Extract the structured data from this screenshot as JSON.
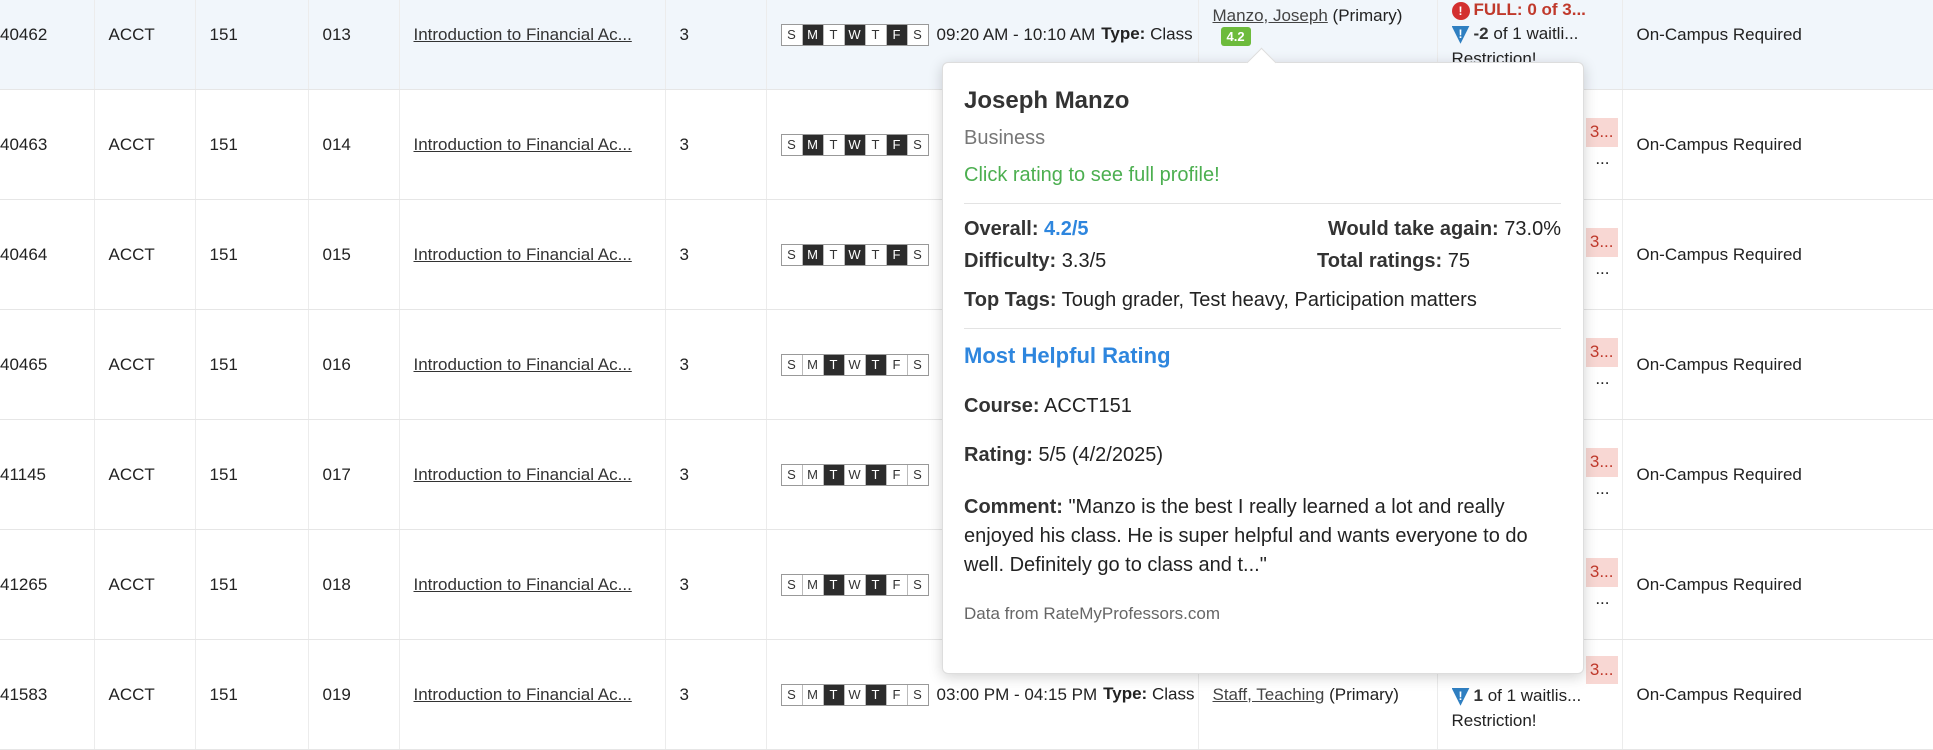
{
  "rows": [
    {
      "crn": "40462",
      "subject": "ACCT",
      "course": "151",
      "section": "013",
      "title": "Introduction to Financial Ac...",
      "credits": "3",
      "days_on": [
        false,
        true,
        false,
        true,
        false,
        true,
        false
      ],
      "time": "09:20 AM - 10:10 AM",
      "type_label": "Type:",
      "type_value": "Class",
      "instructor": "Manzo, Joseph",
      "role": "(Primary)",
      "rating": "4.2",
      "seats_status": "FULL:",
      "seats_text": "0 of 3...",
      "wait_count": "-2",
      "wait_text": "of 1 waitli...",
      "restriction": "Restriction!",
      "campus": "On-Campus Required"
    },
    {
      "crn": "40463",
      "subject": "ACCT",
      "course": "151",
      "section": "014",
      "title": "Introduction to Financial Ac...",
      "credits": "3",
      "days_on": [
        false,
        true,
        false,
        true,
        false,
        true,
        false
      ],
      "seats_pill": "3...",
      "seats_more": "...",
      "campus": "On-Campus Required"
    },
    {
      "crn": "40464",
      "subject": "ACCT",
      "course": "151",
      "section": "015",
      "title": "Introduction to Financial Ac...",
      "credits": "3",
      "days_on": [
        false,
        true,
        false,
        true,
        false,
        true,
        false
      ],
      "seats_pill": "3...",
      "seats_more": "...",
      "campus": "On-Campus Required"
    },
    {
      "crn": "40465",
      "subject": "ACCT",
      "course": "151",
      "section": "016",
      "title": "Introduction to Financial Ac...",
      "credits": "3",
      "days_on": [
        false,
        false,
        true,
        false,
        true,
        false,
        false
      ],
      "seats_pill": "3...",
      "seats_more": "...",
      "campus": "On-Campus Required"
    },
    {
      "crn": "41145",
      "subject": "ACCT",
      "course": "151",
      "section": "017",
      "title": "Introduction to Financial Ac...",
      "credits": "3",
      "days_on": [
        false,
        false,
        true,
        false,
        true,
        false,
        false
      ],
      "seats_pill": "3...",
      "seats_more": "...",
      "campus": "On-Campus Required"
    },
    {
      "crn": "41265",
      "subject": "ACCT",
      "course": "151",
      "section": "018",
      "title": "Introduction to Financial Ac...",
      "credits": "3",
      "days_on": [
        false,
        false,
        true,
        false,
        true,
        false,
        false
      ],
      "seats_pill": "3...",
      "seats_more": "...",
      "campus": "On-Campus Required"
    },
    {
      "crn": "41583",
      "subject": "ACCT",
      "course": "151",
      "section": "019",
      "title": "Introduction to Financial Ac...",
      "credits": "3",
      "days_on": [
        false,
        false,
        true,
        false,
        true,
        false,
        false
      ],
      "time": "03:00 PM - 04:15 PM",
      "type_label": "Type:",
      "type_value": "Class",
      "instructor": "Staff, Teaching",
      "role": "(Primary)",
      "seats_pill": "3...",
      "wait_count": "1",
      "wait_text": "of 1 waitlis...",
      "restriction": "Restriction!",
      "campus": "On-Campus Required"
    }
  ],
  "day_letters": [
    "S",
    "M",
    "T",
    "W",
    "T",
    "F",
    "S"
  ],
  "popover": {
    "name": "Joseph Manzo",
    "department": "Business",
    "profile_link": "Click rating to see full profile!",
    "overall_label": "Overall:",
    "overall_value": "4.2/5",
    "again_label": "Would take again:",
    "again_value": "73.0%",
    "difficulty_label": "Difficulty:",
    "difficulty_value": "3.3/5",
    "total_label": "Total ratings:",
    "total_value": "75",
    "tags_label": "Top Tags:",
    "tags_value": "Tough grader, Test heavy, Participation matters",
    "helpful_heading": "Most Helpful Rating",
    "course_label": "Course:",
    "course_value": "ACCT151",
    "rating_label": "Rating:",
    "rating_value": "5/5 (4/2/2025)",
    "comment_label": "Comment:",
    "comment_value": "\"Manzo is the best I really learned a lot and really enjoyed his class. He is super helpful and wants everyone to do well. Definitely go to class and t...\"",
    "source": "Data from RateMyProfessors.com"
  },
  "colors": {
    "accent": "#2e86de",
    "link_green": "#4caf50",
    "rating_badge": "#6dbb3c",
    "full_red": "#c0392b",
    "row_highlight": "#f1f6fb"
  }
}
